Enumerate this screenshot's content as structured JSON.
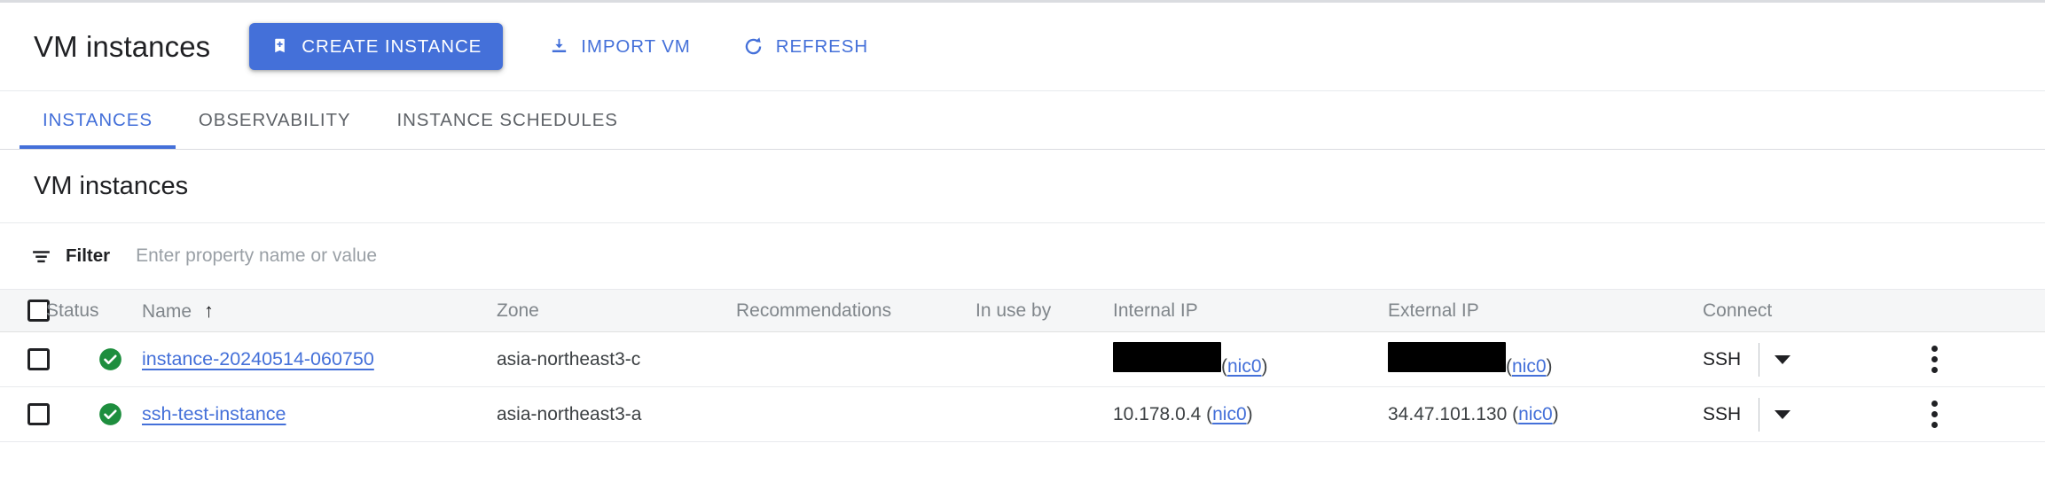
{
  "toolbar": {
    "title": "VM instances",
    "create_label": "CREATE INSTANCE",
    "import_label": "IMPORT VM",
    "refresh_label": "REFRESH",
    "accent_color": "#4470d9"
  },
  "tabs": [
    {
      "label": "INSTANCES",
      "active": true
    },
    {
      "label": "OBSERVABILITY",
      "active": false
    },
    {
      "label": "INSTANCE SCHEDULES",
      "active": false
    }
  ],
  "section": {
    "title": "VM instances"
  },
  "filter": {
    "label": "Filter",
    "placeholder": "Enter property name or value",
    "value": ""
  },
  "table": {
    "columns": [
      {
        "key": "status",
        "label": "Status"
      },
      {
        "key": "name",
        "label": "Name",
        "sort": "↑"
      },
      {
        "key": "zone",
        "label": "Zone"
      },
      {
        "key": "recommendations",
        "label": "Recommendations"
      },
      {
        "key": "in_use_by",
        "label": "In use by"
      },
      {
        "key": "internal_ip",
        "label": "Internal IP"
      },
      {
        "key": "external_ip",
        "label": "External IP"
      },
      {
        "key": "connect",
        "label": "Connect"
      }
    ],
    "rows": [
      {
        "checked": false,
        "status": "running",
        "name": "instance-20240514-060750",
        "zone": "asia-northeast3-c",
        "recommendations": "",
        "in_use_by": "",
        "internal_ip": "",
        "internal_ip_redacted": true,
        "internal_nic": "nic0",
        "external_ip": "",
        "external_ip_redacted": true,
        "external_nic": "nic0",
        "connect": "SSH"
      },
      {
        "checked": false,
        "status": "running",
        "name": "ssh-test-instance",
        "zone": "asia-northeast3-a",
        "recommendations": "",
        "in_use_by": "",
        "internal_ip": "10.178.0.4",
        "internal_ip_redacted": false,
        "internal_nic": "nic0",
        "external_ip": "34.47.101.130",
        "external_ip_redacted": false,
        "external_nic": "nic0",
        "connect": "SSH"
      }
    ]
  },
  "icons": {
    "create": "add-instance-icon",
    "import": "download-icon",
    "refresh": "refresh-icon",
    "filter": "filter-icon",
    "status": "check-circle-icon",
    "more": "more-vert-icon"
  },
  "colors": {
    "status_green": "#1e8e3e",
    "link_blue": "#4470d9",
    "header_gray": "#80868b"
  }
}
